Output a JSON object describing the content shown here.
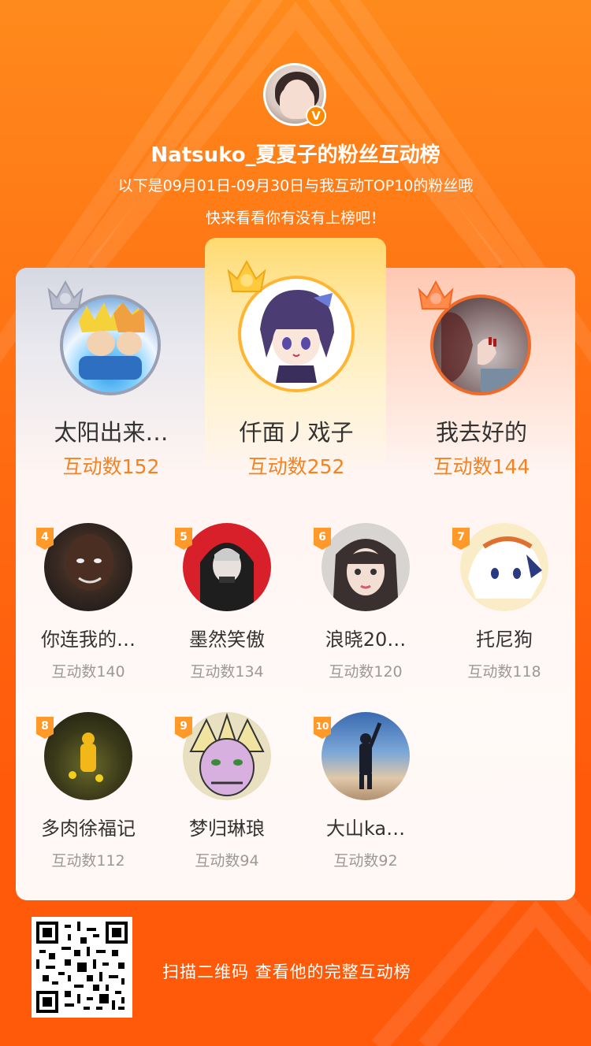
{
  "header": {
    "title": "Natsuko_夏夏子的粉丝互动榜",
    "subtitle_line1": "以下是09月01日-09月30日与我互动TOP10的粉丝哦",
    "subtitle_line2": "快来看看你有没有上榜吧！",
    "verified_mark": "V"
  },
  "top3": [
    {
      "rank": 2,
      "name": "太阳出来…",
      "count_label": "互动数152",
      "crown_color": "silver",
      "avatar": "anime-character-blue"
    },
    {
      "rank": 1,
      "name": "仟面丿戏子",
      "count_label": "互动数252",
      "crown_color": "gold",
      "avatar": "anime-girl-purple-hair"
    },
    {
      "rank": 3,
      "name": "我去好的",
      "count_label": "互动数144",
      "crown_color": "bronze",
      "avatar": "photo-hand-red-nails"
    }
  ],
  "ranks": [
    {
      "rank": "4",
      "name": "你连我的…",
      "count_label": "互动数140"
    },
    {
      "rank": "5",
      "name": "墨然笑傲",
      "count_label": "互动数134"
    },
    {
      "rank": "6",
      "name": "浪晓20…",
      "count_label": "互动数120"
    },
    {
      "rank": "7",
      "name": "托尼狗",
      "count_label": "互动数118"
    },
    {
      "rank": "8",
      "name": "多肉徐福记",
      "count_label": "互动数112"
    },
    {
      "rank": "9",
      "name": "梦归琳琅",
      "count_label": "互动数94"
    },
    {
      "rank": "10",
      "name": "大山ka…",
      "count_label": "互动数92"
    }
  ],
  "footer": {
    "text": "扫描二维码 查看他的完整互动榜"
  },
  "colors": {
    "background": "#ff6d12",
    "count_top": "#f5821f",
    "count_other": "#999999",
    "badge": "#ff9a2a"
  }
}
